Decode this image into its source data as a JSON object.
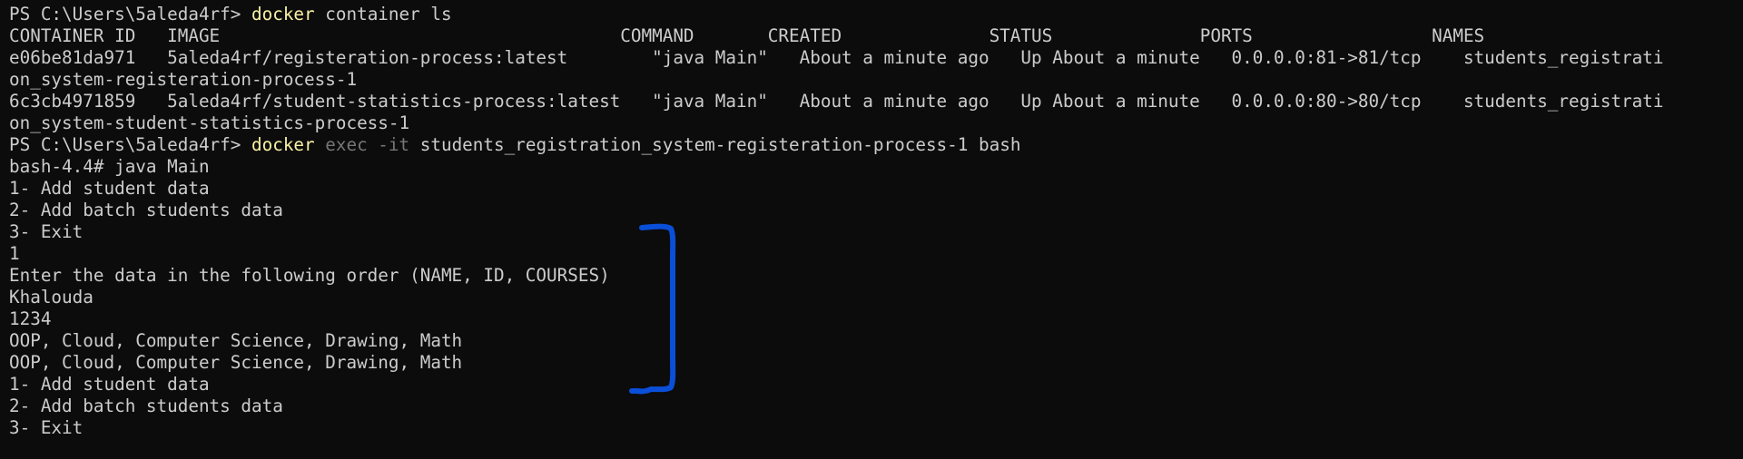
{
  "terminal": {
    "lines": [
      {
        "type": "prompt",
        "prompt": "PS C:\\Users\\5aleda4rf> ",
        "cmd": "docker",
        "flag": "",
        "rest": " container ls"
      },
      {
        "type": "text",
        "text": "CONTAINER ID   IMAGE                                      COMMAND       CREATED              STATUS              PORTS                 NAMES"
      },
      {
        "type": "text",
        "text": "e06be81da971   5aleda4rf/registeration-process:latest        \"java Main\"   About a minute ago   Up About a minute   0.0.0.0:81->81/tcp    students_registrati"
      },
      {
        "type": "text",
        "text": "on_system-registeration-process-1"
      },
      {
        "type": "text",
        "text": "6c3cb4971859   5aleda4rf/student-statistics-process:latest   \"java Main\"   About a minute ago   Up About a minute   0.0.0.0:80->80/tcp    students_registrati"
      },
      {
        "type": "text",
        "text": "on_system-student-statistics-process-1"
      },
      {
        "type": "prompt",
        "prompt": "PS C:\\Users\\5aleda4rf> ",
        "cmd": "docker",
        "flag": " exec -it",
        "rest": " students_registration_system-registeration-process-1 bash"
      },
      {
        "type": "text",
        "text": "bash-4.4# java Main"
      },
      {
        "type": "text",
        "text": "1- Add student data"
      },
      {
        "type": "text",
        "text": "2- Add batch students data"
      },
      {
        "type": "text",
        "text": "3- Exit"
      },
      {
        "type": "text",
        "text": "1"
      },
      {
        "type": "text",
        "text": "Enter the data in the following order (NAME, ID, COURSES)"
      },
      {
        "type": "text",
        "text": "Khalouda"
      },
      {
        "type": "text",
        "text": "1234"
      },
      {
        "type": "text",
        "text": "OOP, Cloud, Computer Science, Drawing, Math"
      },
      {
        "type": "text",
        "text": "OOP, Cloud, Computer Science, Drawing, Math"
      },
      {
        "type": "text",
        "text": "1- Add student data"
      },
      {
        "type": "text",
        "text": "2- Add batch students data"
      },
      {
        "type": "text",
        "text": "3- Exit"
      }
    ]
  },
  "annotation": {
    "shape": "bracket-right",
    "color": "#0a4fd8"
  },
  "colors": {
    "background": "#0c0c0c",
    "text": "#cccccc",
    "command": "#f9f1a5",
    "flag": "#767676"
  }
}
